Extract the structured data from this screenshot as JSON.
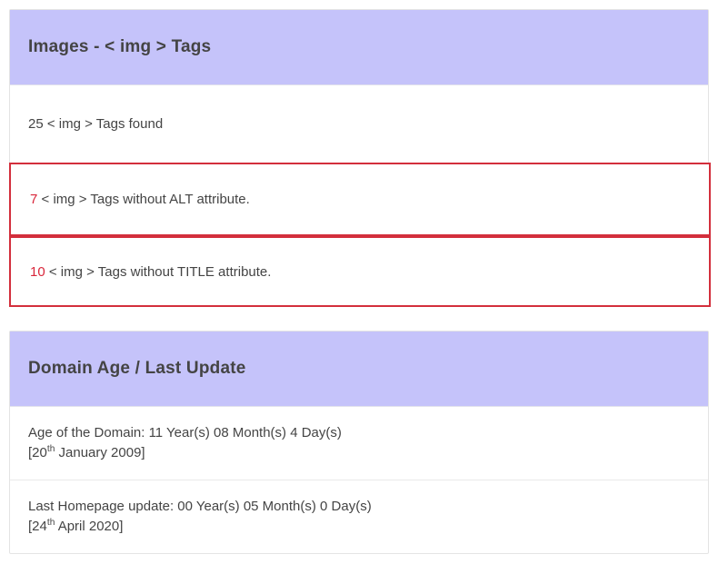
{
  "images_panel": {
    "title": "Images - < img > Tags",
    "rows": [
      {
        "count": "25",
        "text": " < img > Tags found",
        "highlighted": false
      },
      {
        "count": "7",
        "text": " < img > Tags without ALT attribute.",
        "highlighted": true
      },
      {
        "count": "10",
        "text": " < img > Tags without TITLE attribute.",
        "highlighted": true
      }
    ]
  },
  "domain_panel": {
    "title": "Domain Age / Last Update",
    "rows": [
      {
        "line1": "Age of the Domain: 11 Year(s) 08 Month(s) 4 Day(s)",
        "date_prefix": "[20",
        "date_ordinal": "th",
        "date_suffix": " January 2009]"
      },
      {
        "line1": "Last Homepage update: 00 Year(s) 05 Month(s) 0 Day(s)",
        "date_prefix": "[24",
        "date_ordinal": "th",
        "date_suffix": " April 2020]"
      }
    ]
  },
  "colors": {
    "header_background": "#c5c3fa",
    "alert_border": "#d32f3c",
    "alert_count_text": "#d9263a",
    "body_text": "#444444",
    "panel_border": "#e4e4e4"
  }
}
